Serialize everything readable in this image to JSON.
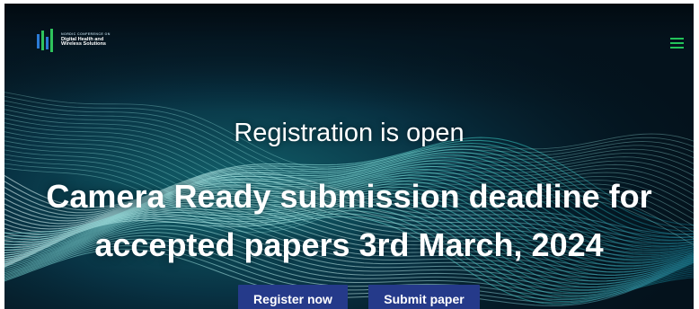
{
  "header": {
    "logo": {
      "small_text": "NORDIC CONFERENCE ON",
      "line1": "Digital Health and",
      "line2": "Wireless Solutions"
    },
    "menu_icon": "hamburger-menu-icon"
  },
  "hero": {
    "subtitle": "Registration is open",
    "headline_line1": "Camera Ready submission deadline for",
    "headline_line2": "accepted papers 3rd March, 2024",
    "buttons": {
      "register": "Register now",
      "submit": "Submit paper"
    }
  },
  "colors": {
    "background": "#04121c",
    "wave_light": "#bff6f2",
    "wave_teal": "#3ad0c8",
    "menu_green": "#23c45a",
    "button": "#253a8a",
    "logo_green": "#2fc35c",
    "logo_blue": "#2b7bd6"
  }
}
